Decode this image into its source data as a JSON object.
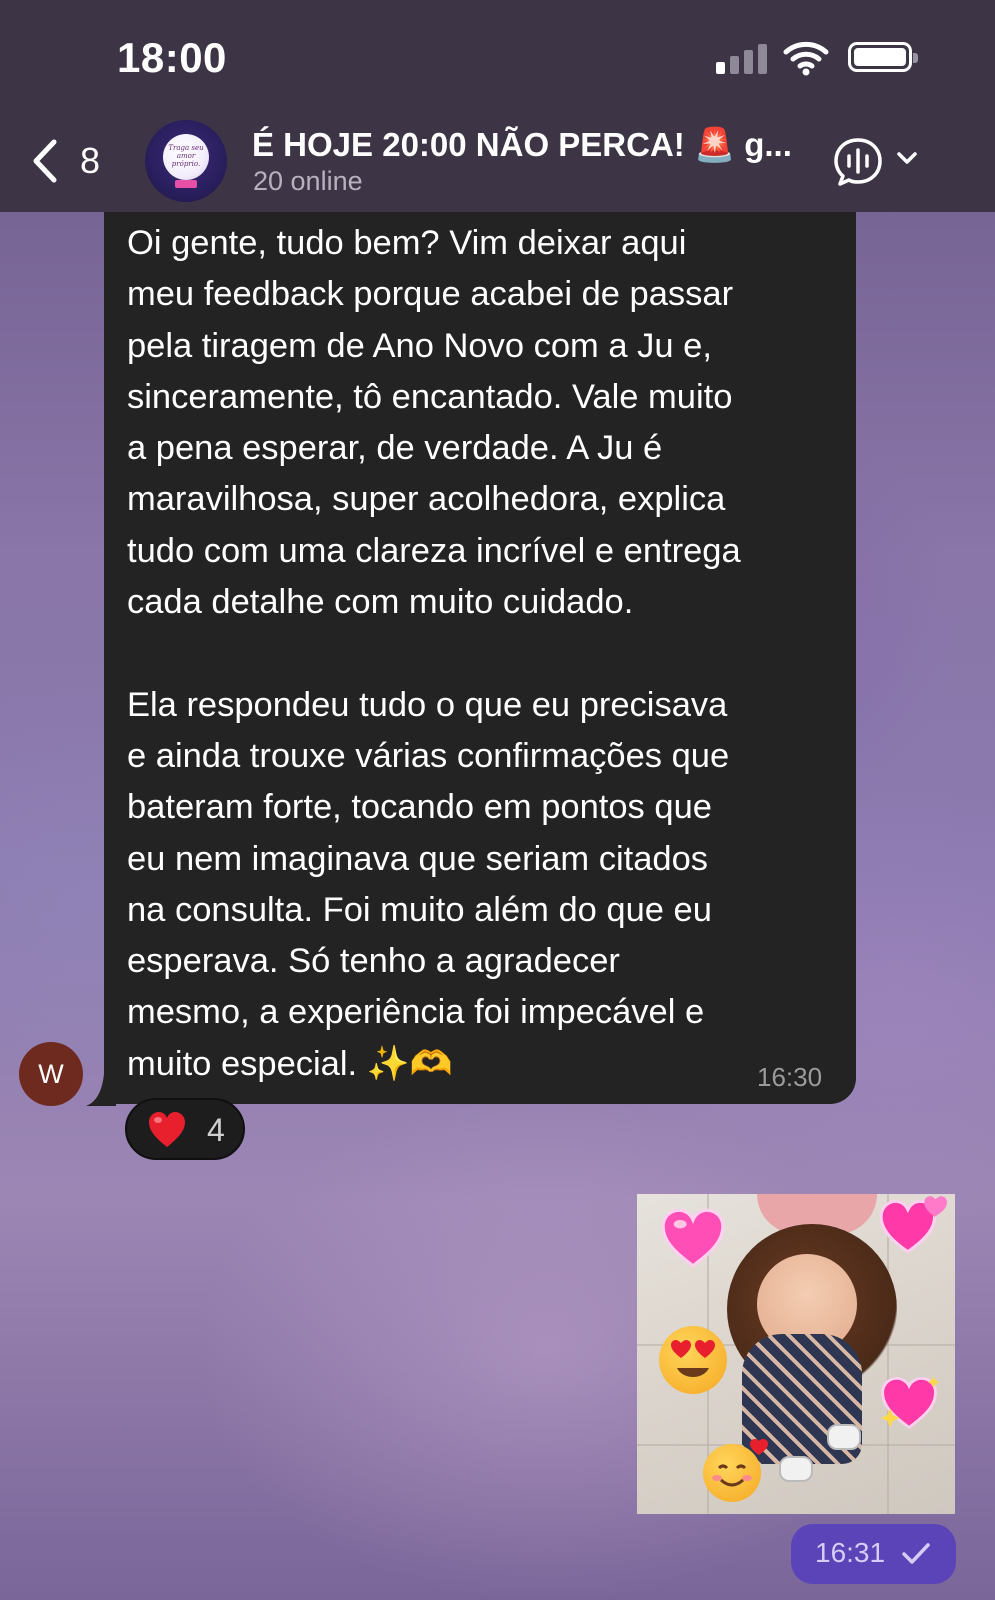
{
  "status_bar": {
    "time": "18:00"
  },
  "header": {
    "back_count": "8",
    "avatar_text": "Traga seu amor próprio.",
    "title": "É HOJE 20:00 NÃO PERCA! 🚨 g...",
    "status": "20 online"
  },
  "message": {
    "sender_initial": "W",
    "text": "Oi gente, tudo bem? Vim deixar aqui\nmeu feedback porque acabei de passar\npela tiragem de Ano Novo com a Ju e,\nsinceramente, tô encantado. Vale muito\na pena esperar, de verdade. A Ju é\nmaravilhosa, super acolhedora, explica\ntudo com uma clareza incrível e entrega\ncada detalhe com muito cuidado.\n\nEla respondeu tudo o que eu precisava\ne ainda trouxe várias confirmações que\nbateram forte, tocando em pontos que\neu nem imaginava que seriam citados\nna consulta. Foi muito além do que eu\nesperava. Só tenho a agradecer\nmesmo, a experiência foi impecável e\nmuito especial. ✨🫶",
    "time": "16:30",
    "reaction_emoji": "❤️",
    "reaction_count": "4"
  },
  "photo_message": {
    "time": "16:31"
  },
  "colors": {
    "header_bg": "#3d3546",
    "bubble_bg": "#232323",
    "sender_avatar": "#6e2a1f",
    "outgoing_time_bg": "#5b43b8"
  }
}
